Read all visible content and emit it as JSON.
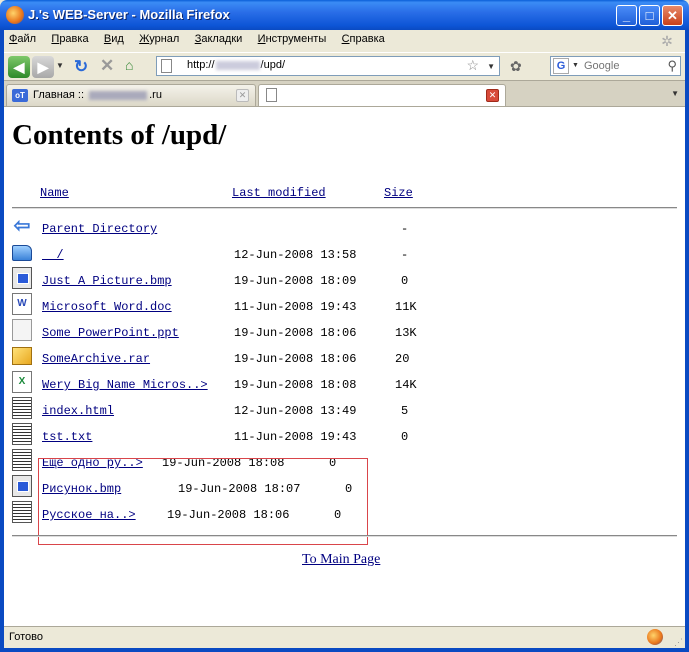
{
  "window": {
    "title": "J.'s WEB-Server - Mozilla Firefox",
    "minimize": "_",
    "maximize": "□",
    "close": "✕"
  },
  "menu": [
    {
      "pre": "",
      "u": "Ф",
      "post": "айл"
    },
    {
      "pre": "",
      "u": "П",
      "post": "равка"
    },
    {
      "pre": "",
      "u": "В",
      "post": "ид"
    },
    {
      "pre": "",
      "u": "Ж",
      "post": "урнал"
    },
    {
      "pre": "",
      "u": "З",
      "post": "акладки"
    },
    {
      "pre": "",
      "u": "И",
      "post": "нструменты"
    },
    {
      "pre": "",
      "u": "С",
      "post": "правка"
    }
  ],
  "nav": {
    "url_prefix": "http://",
    "url_suffix": "/upd/",
    "search_placeholder": "Google"
  },
  "tabs": [
    {
      "label_prefix": "Главная :: ",
      "label_suffix": ".ru",
      "active": false
    },
    {
      "label_prefix": "",
      "label_suffix": "",
      "active": true
    }
  ],
  "page": {
    "heading": "Contents of /upd/",
    "columns": {
      "name": "Name",
      "modified": "Last modified",
      "size": "Size"
    },
    "entries": [
      {
        "icon": "back-icon",
        "name": "Parent Directory",
        "date": "",
        "size": "-"
      },
      {
        "icon": "folder-icon",
        "name": "  /",
        "date": "12-Jun-2008 13:58",
        "size": "-"
      },
      {
        "icon": "image-file-icon",
        "name": "Just A Picture.bmp",
        "date": "19-Jun-2008 18:09",
        "size": "0"
      },
      {
        "icon": "word-doc-icon",
        "name": "Microsoft Word.doc",
        "date": "11-Jun-2008 19:43",
        "size": "11K"
      },
      {
        "icon": "blank-file-icon",
        "name": "Some PowerPoint.ppt",
        "date": "19-Jun-2008 18:06",
        "size": "13K"
      },
      {
        "icon": "archive-icon",
        "name": "SomeArchive.rar",
        "date": "19-Jun-2008 18:06",
        "size": "20"
      },
      {
        "icon": "excel-file-icon",
        "name": "Wery Big Name Micros..>",
        "date": "19-Jun-2008 18:08",
        "size": "14K"
      },
      {
        "icon": "text-file-icon",
        "name": "index.html",
        "date": "12-Jun-2008 13:49",
        "size": "5"
      },
      {
        "icon": "text-file-icon",
        "name": "tst.txt",
        "date": "11-Jun-2008 19:43",
        "size": "0"
      },
      {
        "icon": "text-file-icon",
        "name": "Еще одно ру..>",
        "date": "19-Jun-2008 18:08",
        "size": "0"
      },
      {
        "icon": "image-file-icon",
        "name": "Рисунок.bmp",
        "date": "19-Jun-2008 18:07",
        "size": "0"
      },
      {
        "icon": "text-file-icon",
        "name": "Русское на..>",
        "date": "19-Jun-2008 18:06",
        "size": "0"
      }
    ],
    "main_link": "To Main Page"
  },
  "status": {
    "text": "Готово"
  }
}
